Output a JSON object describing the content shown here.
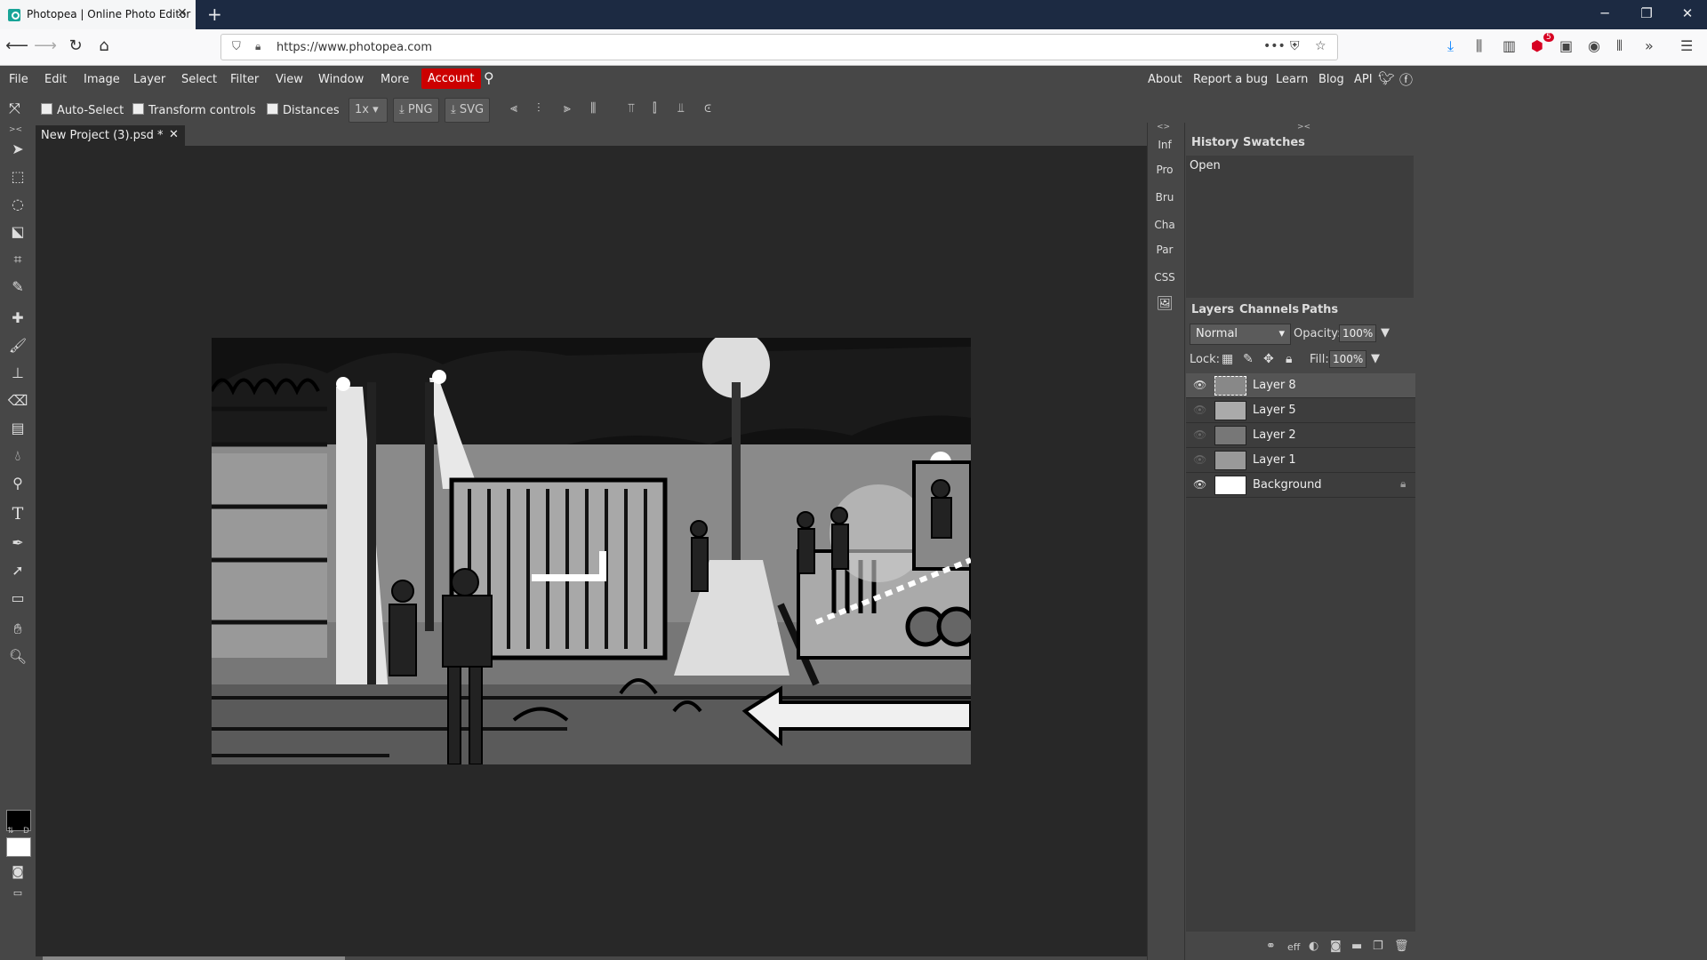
{
  "browser": {
    "tab_title": "Photopea | Online Photo Editor",
    "new_tab_label": "+",
    "url": "https://www.photopea.com",
    "badge_count": "5"
  },
  "menu": {
    "items": [
      "File",
      "Edit",
      "Image",
      "Layer",
      "Select",
      "Filter",
      "View",
      "Window",
      "More"
    ],
    "account": "Account",
    "right_links": [
      "About",
      "Report a bug",
      "Learn",
      "Blog",
      "API"
    ]
  },
  "options": {
    "auto_select": "Auto-Select",
    "transform_controls": "Transform controls",
    "distances": "Distances",
    "zoom": "1x",
    "png": "PNG",
    "svg": "SVG"
  },
  "document": {
    "tab_title": "New Project (3).psd *"
  },
  "side_panel": {
    "items": [
      "Inf",
      "Pro",
      "Bru",
      "Cha",
      "Par",
      "CSS"
    ]
  },
  "history_panel": {
    "tabs": [
      "History",
      "Swatches"
    ],
    "entries": [
      "Open"
    ]
  },
  "layers_panel": {
    "tabs": [
      "Layers",
      "Channels",
      "Paths"
    ],
    "blend_mode": "Normal",
    "opacity_label": "Opacity:",
    "opacity": "100%",
    "lock_label": "Lock:",
    "fill_label": "Fill:",
    "fill": "100%",
    "layers": [
      {
        "name": "Layer 8",
        "visible": true,
        "selected": true
      },
      {
        "name": "Layer 5",
        "visible": false,
        "selected": false
      },
      {
        "name": "Layer 2",
        "visible": false,
        "selected": false
      },
      {
        "name": "Layer 1",
        "visible": false,
        "selected": false
      },
      {
        "name": "Background",
        "visible": true,
        "selected": false,
        "locked": true
      }
    ],
    "footer_eff": "eff"
  },
  "colors": {
    "accent_account": "#cc0000",
    "ui_bg": "#474747",
    "canvas_bg": "#282828"
  }
}
